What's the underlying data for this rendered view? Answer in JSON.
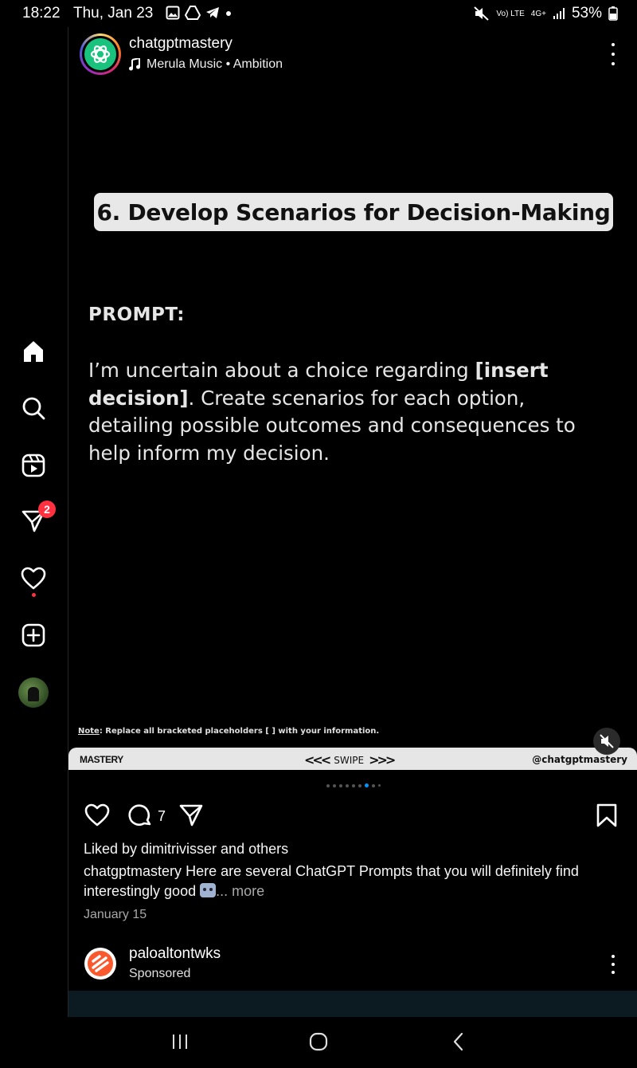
{
  "status_bar": {
    "time": "18:22",
    "date": "Thu, Jan 23",
    "network_top": "Vo) LTE",
    "network_type": "4G+",
    "battery": "53%"
  },
  "sidebar": {
    "items": [
      {
        "name": "home",
        "icon": "home-icon"
      },
      {
        "name": "search",
        "icon": "search-icon"
      },
      {
        "name": "reels",
        "icon": "reels-icon"
      },
      {
        "name": "messages",
        "icon": "direct-message-icon",
        "badge": "2"
      },
      {
        "name": "notifications",
        "icon": "heart-icon"
      },
      {
        "name": "create",
        "icon": "plus-square-icon"
      },
      {
        "name": "profile",
        "icon": "avatar"
      }
    ]
  },
  "post": {
    "username": "chatgptmastery",
    "music": "Merula Music • Ambition",
    "slide": {
      "title": "6. Develop Scenarios for Decision-Making",
      "prompt_label": "PROMPT:",
      "prompt_text_1": "I’m uncertain about a choice regarding ",
      "prompt_bold": "[insert decision]",
      "prompt_text_2": ". Create scenarios for each option, detailing possible outcomes and consequences to help inform my decision.",
      "note_label": "Note",
      "note_text": ": Replace all bracketed placeholders [ ] with your information.",
      "footer_left": "MASTERY",
      "footer_mid": "SWIPE",
      "footer_right": "@chatgptmastery"
    },
    "carousel": {
      "total_dots": 9,
      "active_index": 6
    },
    "comment_count": "7",
    "likes": "Liked by dimitrivisser and others",
    "caption_user": "chatgptmastery",
    "caption_text": " Here are several ChatGPT Prompts that you will definitely find interestingly good ",
    "caption_more": "... more",
    "date": "January 15"
  },
  "sponsored": {
    "username": "paloaltontwks",
    "label": "Sponsored"
  },
  "colors": {
    "accent": "#0095f6",
    "badge": "#ff3040",
    "chatgpt_green": "#19c37d",
    "sponsor_orange": "#fa582d"
  }
}
